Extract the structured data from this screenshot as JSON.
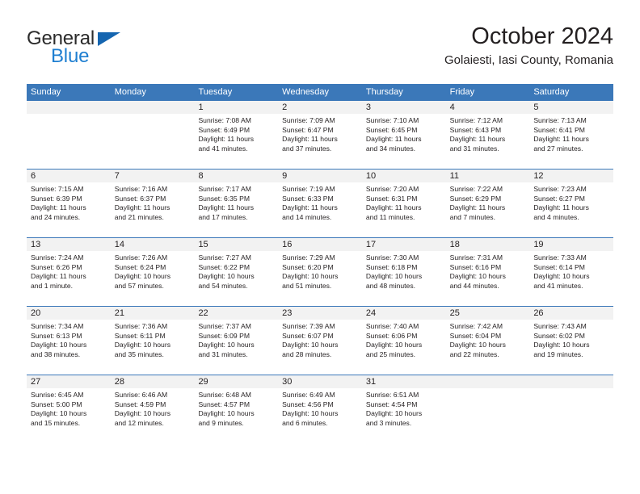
{
  "brand": {
    "name_part1": "General",
    "name_part2": "Blue",
    "triangle_color": "#1565b0",
    "blue_color": "#1f7fd1"
  },
  "header": {
    "title": "October 2024",
    "subtitle": "Golaiesti, Iasi County, Romania"
  },
  "colors": {
    "header_blue": "#3b78b9",
    "day_band_gray": "#f2f2f2",
    "text": "#231f20"
  },
  "weekdays": [
    "Sunday",
    "Monday",
    "Tuesday",
    "Wednesday",
    "Thursday",
    "Friday",
    "Saturday"
  ],
  "weeks": [
    [
      {
        "day": "",
        "empty": true
      },
      {
        "day": "",
        "empty": true
      },
      {
        "day": "1",
        "sunrise": "Sunrise: 7:08 AM",
        "sunset": "Sunset: 6:49 PM",
        "daylight1": "Daylight: 11 hours",
        "daylight2": "and 41 minutes."
      },
      {
        "day": "2",
        "sunrise": "Sunrise: 7:09 AM",
        "sunset": "Sunset: 6:47 PM",
        "daylight1": "Daylight: 11 hours",
        "daylight2": "and 37 minutes."
      },
      {
        "day": "3",
        "sunrise": "Sunrise: 7:10 AM",
        "sunset": "Sunset: 6:45 PM",
        "daylight1": "Daylight: 11 hours",
        "daylight2": "and 34 minutes."
      },
      {
        "day": "4",
        "sunrise": "Sunrise: 7:12 AM",
        "sunset": "Sunset: 6:43 PM",
        "daylight1": "Daylight: 11 hours",
        "daylight2": "and 31 minutes."
      },
      {
        "day": "5",
        "sunrise": "Sunrise: 7:13 AM",
        "sunset": "Sunset: 6:41 PM",
        "daylight1": "Daylight: 11 hours",
        "daylight2": "and 27 minutes."
      }
    ],
    [
      {
        "day": "6",
        "sunrise": "Sunrise: 7:15 AM",
        "sunset": "Sunset: 6:39 PM",
        "daylight1": "Daylight: 11 hours",
        "daylight2": "and 24 minutes."
      },
      {
        "day": "7",
        "sunrise": "Sunrise: 7:16 AM",
        "sunset": "Sunset: 6:37 PM",
        "daylight1": "Daylight: 11 hours",
        "daylight2": "and 21 minutes."
      },
      {
        "day": "8",
        "sunrise": "Sunrise: 7:17 AM",
        "sunset": "Sunset: 6:35 PM",
        "daylight1": "Daylight: 11 hours",
        "daylight2": "and 17 minutes."
      },
      {
        "day": "9",
        "sunrise": "Sunrise: 7:19 AM",
        "sunset": "Sunset: 6:33 PM",
        "daylight1": "Daylight: 11 hours",
        "daylight2": "and 14 minutes."
      },
      {
        "day": "10",
        "sunrise": "Sunrise: 7:20 AM",
        "sunset": "Sunset: 6:31 PM",
        "daylight1": "Daylight: 11 hours",
        "daylight2": "and 11 minutes."
      },
      {
        "day": "11",
        "sunrise": "Sunrise: 7:22 AM",
        "sunset": "Sunset: 6:29 PM",
        "daylight1": "Daylight: 11 hours",
        "daylight2": "and 7 minutes."
      },
      {
        "day": "12",
        "sunrise": "Sunrise: 7:23 AM",
        "sunset": "Sunset: 6:27 PM",
        "daylight1": "Daylight: 11 hours",
        "daylight2": "and 4 minutes."
      }
    ],
    [
      {
        "day": "13",
        "sunrise": "Sunrise: 7:24 AM",
        "sunset": "Sunset: 6:26 PM",
        "daylight1": "Daylight: 11 hours",
        "daylight2": "and 1 minute."
      },
      {
        "day": "14",
        "sunrise": "Sunrise: 7:26 AM",
        "sunset": "Sunset: 6:24 PM",
        "daylight1": "Daylight: 10 hours",
        "daylight2": "and 57 minutes."
      },
      {
        "day": "15",
        "sunrise": "Sunrise: 7:27 AM",
        "sunset": "Sunset: 6:22 PM",
        "daylight1": "Daylight: 10 hours",
        "daylight2": "and 54 minutes."
      },
      {
        "day": "16",
        "sunrise": "Sunrise: 7:29 AM",
        "sunset": "Sunset: 6:20 PM",
        "daylight1": "Daylight: 10 hours",
        "daylight2": "and 51 minutes."
      },
      {
        "day": "17",
        "sunrise": "Sunrise: 7:30 AM",
        "sunset": "Sunset: 6:18 PM",
        "daylight1": "Daylight: 10 hours",
        "daylight2": "and 48 minutes."
      },
      {
        "day": "18",
        "sunrise": "Sunrise: 7:31 AM",
        "sunset": "Sunset: 6:16 PM",
        "daylight1": "Daylight: 10 hours",
        "daylight2": "and 44 minutes."
      },
      {
        "day": "19",
        "sunrise": "Sunrise: 7:33 AM",
        "sunset": "Sunset: 6:14 PM",
        "daylight1": "Daylight: 10 hours",
        "daylight2": "and 41 minutes."
      }
    ],
    [
      {
        "day": "20",
        "sunrise": "Sunrise: 7:34 AM",
        "sunset": "Sunset: 6:13 PM",
        "daylight1": "Daylight: 10 hours",
        "daylight2": "and 38 minutes."
      },
      {
        "day": "21",
        "sunrise": "Sunrise: 7:36 AM",
        "sunset": "Sunset: 6:11 PM",
        "daylight1": "Daylight: 10 hours",
        "daylight2": "and 35 minutes."
      },
      {
        "day": "22",
        "sunrise": "Sunrise: 7:37 AM",
        "sunset": "Sunset: 6:09 PM",
        "daylight1": "Daylight: 10 hours",
        "daylight2": "and 31 minutes."
      },
      {
        "day": "23",
        "sunrise": "Sunrise: 7:39 AM",
        "sunset": "Sunset: 6:07 PM",
        "daylight1": "Daylight: 10 hours",
        "daylight2": "and 28 minutes."
      },
      {
        "day": "24",
        "sunrise": "Sunrise: 7:40 AM",
        "sunset": "Sunset: 6:06 PM",
        "daylight1": "Daylight: 10 hours",
        "daylight2": "and 25 minutes."
      },
      {
        "day": "25",
        "sunrise": "Sunrise: 7:42 AM",
        "sunset": "Sunset: 6:04 PM",
        "daylight1": "Daylight: 10 hours",
        "daylight2": "and 22 minutes."
      },
      {
        "day": "26",
        "sunrise": "Sunrise: 7:43 AM",
        "sunset": "Sunset: 6:02 PM",
        "daylight1": "Daylight: 10 hours",
        "daylight2": "and 19 minutes."
      }
    ],
    [
      {
        "day": "27",
        "sunrise": "Sunrise: 6:45 AM",
        "sunset": "Sunset: 5:00 PM",
        "daylight1": "Daylight: 10 hours",
        "daylight2": "and 15 minutes."
      },
      {
        "day": "28",
        "sunrise": "Sunrise: 6:46 AM",
        "sunset": "Sunset: 4:59 PM",
        "daylight1": "Daylight: 10 hours",
        "daylight2": "and 12 minutes."
      },
      {
        "day": "29",
        "sunrise": "Sunrise: 6:48 AM",
        "sunset": "Sunset: 4:57 PM",
        "daylight1": "Daylight: 10 hours",
        "daylight2": "and 9 minutes."
      },
      {
        "day": "30",
        "sunrise": "Sunrise: 6:49 AM",
        "sunset": "Sunset: 4:56 PM",
        "daylight1": "Daylight: 10 hours",
        "daylight2": "and 6 minutes."
      },
      {
        "day": "31",
        "sunrise": "Sunrise: 6:51 AM",
        "sunset": "Sunset: 4:54 PM",
        "daylight1": "Daylight: 10 hours",
        "daylight2": "and 3 minutes."
      },
      {
        "day": "",
        "empty": true
      },
      {
        "day": "",
        "empty": true
      }
    ]
  ]
}
